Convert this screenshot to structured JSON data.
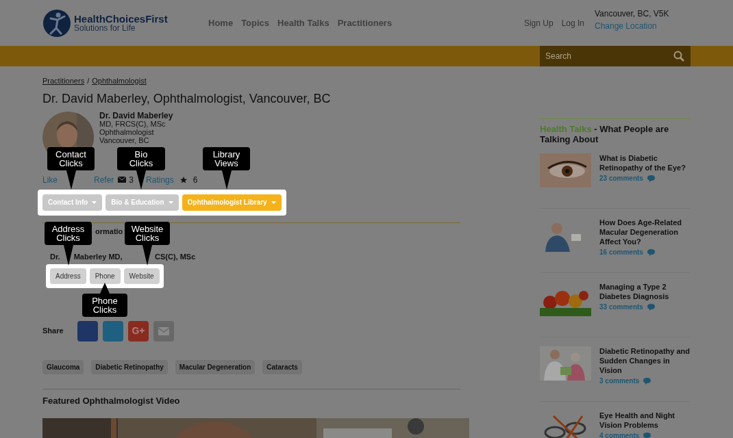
{
  "header": {
    "logo_title": "HealthChoicesFirst",
    "logo_tagline": "Solutions for Life",
    "nav": [
      "Home",
      "Topics",
      "Health Talks",
      "Practitioners"
    ],
    "account": [
      "Sign Up",
      "Log In"
    ],
    "location": "Vancouver, BC, V5K",
    "change_location": "Change Location"
  },
  "search": {
    "placeholder": "Search"
  },
  "breadcrumb": {
    "items": [
      "Practitioners",
      "Ophthalmologist"
    ],
    "separator": "/"
  },
  "page_title": "Dr. David Maberley, Ophthalmologist, Vancouver, BC",
  "profile": {
    "photo": {
      "kind": "picture"
    },
    "name": "Dr. David Maberley",
    "lines": [
      "MD, FRCS(C), MSc",
      "Ophthalmologist",
      "Vancouver, BC"
    ],
    "like": "Like",
    "refer": "Refer",
    "mail_count": "3",
    "ratings": "Ratings",
    "star_count": "6"
  },
  "profile_tabs": [
    {
      "label": "Contact Info",
      "selected": false
    },
    {
      "label": "Bio & Education",
      "selected": false
    },
    {
      "label": "Ophthalmologist Library",
      "selected": true
    }
  ],
  "contact": {
    "heading_fragment": "ormatio",
    "name_fragments": [
      "Dr.",
      "Maberley MD,",
      "CS(C), MSc"
    ],
    "buttons": [
      "Address",
      "Phone",
      "Website"
    ]
  },
  "share": {
    "label": "Share",
    "buttons": [
      {
        "kind": "facebook"
      },
      {
        "kind": "twitter"
      },
      {
        "kind": "google",
        "text": "G+"
      },
      {
        "kind": "email"
      }
    ]
  },
  "tags": [
    "Glaucoma",
    "Diabetic Retinopathy",
    "Macular Degeneration",
    "Cataracts"
  ],
  "video": {
    "heading": "Featured Ophthalmologist Video",
    "frame": {
      "kind": "picture"
    }
  },
  "callouts": [
    {
      "text": "Contact Clicks",
      "kind": "above"
    },
    {
      "text": "Bio Clicks",
      "kind": "above"
    },
    {
      "text": "Library Views",
      "kind": "above"
    },
    {
      "text": "Address Clicks",
      "kind": "above"
    },
    {
      "text": "Website Clicks",
      "kind": "above"
    },
    {
      "text": "Phone Clicks",
      "kind": "below"
    }
  ],
  "sidebar": {
    "heading_highlight": "Health Talks",
    "heading_rest": " - What People are Talking About",
    "items": [
      {
        "title": "What is Diabetic Retinopathy of the Eye?",
        "comments": "23 comments",
        "image": {
          "kind": "eye"
        }
      },
      {
        "title": "How Does Age-Related Macular Degeneration Affect You?",
        "comments": "16 comments",
        "image": {
          "kind": "man"
        }
      },
      {
        "title": "Managing a Type 2 Diabetes Diagnosis",
        "comments": "33 comments",
        "image": {
          "kind": "vegetables"
        }
      },
      {
        "title": "Diabetic Retinopathy and Sudden Changes in Vision",
        "comments": "3 comments",
        "image": {
          "kind": "doctor"
        }
      },
      {
        "title": "Eye Health and Night Vision Problems",
        "comments": "4 comments",
        "image": {
          "kind": "glasses"
        }
      }
    ]
  }
}
